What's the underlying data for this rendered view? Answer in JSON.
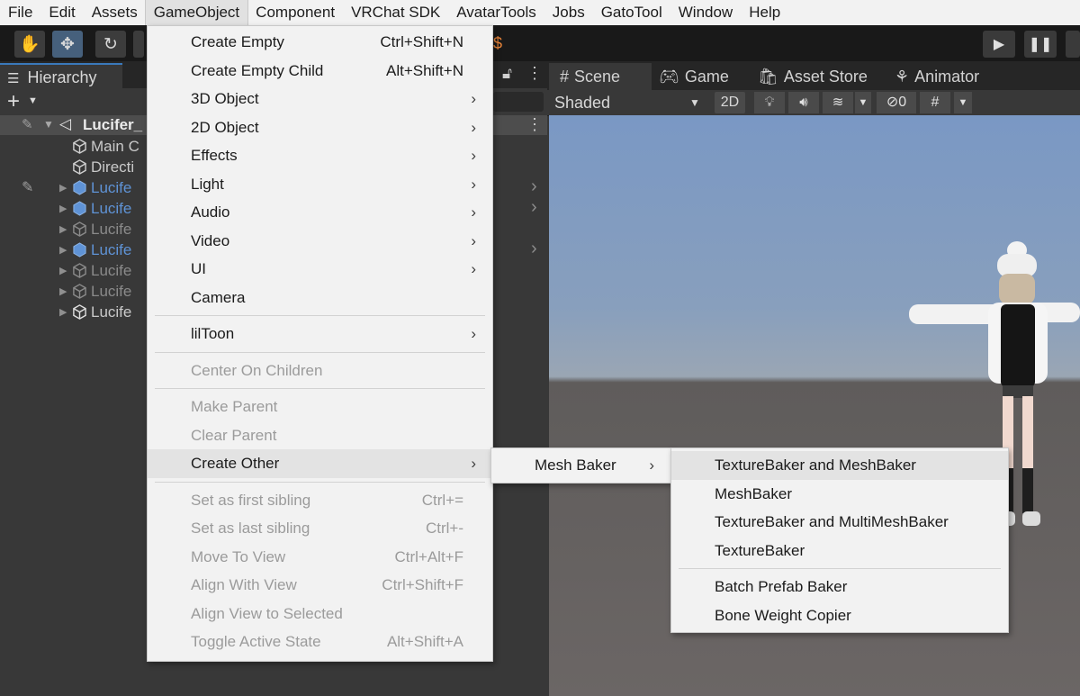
{
  "menubar": [
    "File",
    "Edit",
    "Assets",
    "GameObject",
    "Component",
    "VRChat SDK",
    "AvatarTools",
    "Jobs",
    "GatoTool",
    "Window",
    "Help"
  ],
  "hierarchy": {
    "tab_label": "Hierarchy",
    "scene_name": "Lucifer_",
    "items": [
      {
        "label": "Main C",
        "style": "normal"
      },
      {
        "label": "Directi",
        "style": "normal"
      },
      {
        "label": "Lucife",
        "style": "blue"
      },
      {
        "label": "Lucife",
        "style": "blue"
      },
      {
        "label": "Lucife",
        "style": "dim"
      },
      {
        "label": "Lucife",
        "style": "blue"
      },
      {
        "label": "Lucife",
        "style": "dim"
      },
      {
        "label": "Lucife",
        "style": "dim"
      },
      {
        "label": "Lucife",
        "style": "normal"
      }
    ]
  },
  "scene": {
    "tabs": [
      "Scene",
      "Game",
      "Asset Store",
      "Animator"
    ],
    "shading": "Shaded",
    "mode_2d": "2D",
    "hidden_count": "0"
  },
  "gameobject_menu": [
    {
      "label": "Create Empty",
      "shortcut": "Ctrl+Shift+N"
    },
    {
      "label": "Create Empty Child",
      "shortcut": "Alt+Shift+N"
    },
    {
      "label": "3D Object",
      "submenu": true
    },
    {
      "label": "2D Object",
      "submenu": true
    },
    {
      "label": "Effects",
      "submenu": true
    },
    {
      "label": "Light",
      "submenu": true
    },
    {
      "label": "Audio",
      "submenu": true
    },
    {
      "label": "Video",
      "submenu": true
    },
    {
      "label": "UI",
      "submenu": true
    },
    {
      "label": "Camera"
    },
    {
      "separator": true
    },
    {
      "label": "lilToon",
      "submenu": true
    },
    {
      "separator": true
    },
    {
      "label": "Center On Children",
      "disabled": true
    },
    {
      "separator": true
    },
    {
      "label": "Make Parent",
      "disabled": true
    },
    {
      "label": "Clear Parent",
      "disabled": true
    },
    {
      "label": "Create Other",
      "submenu": true,
      "highlighted": true
    },
    {
      "separator": true
    },
    {
      "label": "Set as first sibling",
      "shortcut": "Ctrl+=",
      "disabled": true
    },
    {
      "label": "Set as last sibling",
      "shortcut": "Ctrl+-",
      "disabled": true
    },
    {
      "label": "Move To View",
      "shortcut": "Ctrl+Alt+F",
      "disabled": true
    },
    {
      "label": "Align With View",
      "shortcut": "Ctrl+Shift+F",
      "disabled": true
    },
    {
      "label": "Align View to Selected",
      "disabled": true
    },
    {
      "label": "Toggle Active State",
      "shortcut": "Alt+Shift+A",
      "disabled": true
    }
  ],
  "create_other_menu": [
    {
      "label": "Mesh Baker",
      "submenu": true
    }
  ],
  "mesh_baker_menu": [
    {
      "label": "TextureBaker and MeshBaker",
      "highlighted": true
    },
    {
      "label": "MeshBaker"
    },
    {
      "label": "TextureBaker and MultiMeshBaker"
    },
    {
      "label": "TextureBaker"
    },
    {
      "separator": true
    },
    {
      "label": "Batch Prefab Baker"
    },
    {
      "label": "Bone Weight Copier"
    }
  ],
  "colors": {
    "accent": "#3a79bb",
    "hierarchy_prefab_text": "#5f93d6",
    "menu_bg": "#f2f2f2",
    "panel_bg": "#383838"
  },
  "icons": [
    "hand-icon",
    "move-icon",
    "rotate-icon",
    "play-icon",
    "pause-icon",
    "unity-logo-icon",
    "cube-icon",
    "hash-icon",
    "gamepad-icon",
    "store-icon",
    "animator-icon",
    "lightbulb-icon",
    "audio-icon",
    "effects-icon",
    "visibility-icon",
    "gizmo-icon",
    "lock-icon",
    "kebab-icon"
  ]
}
